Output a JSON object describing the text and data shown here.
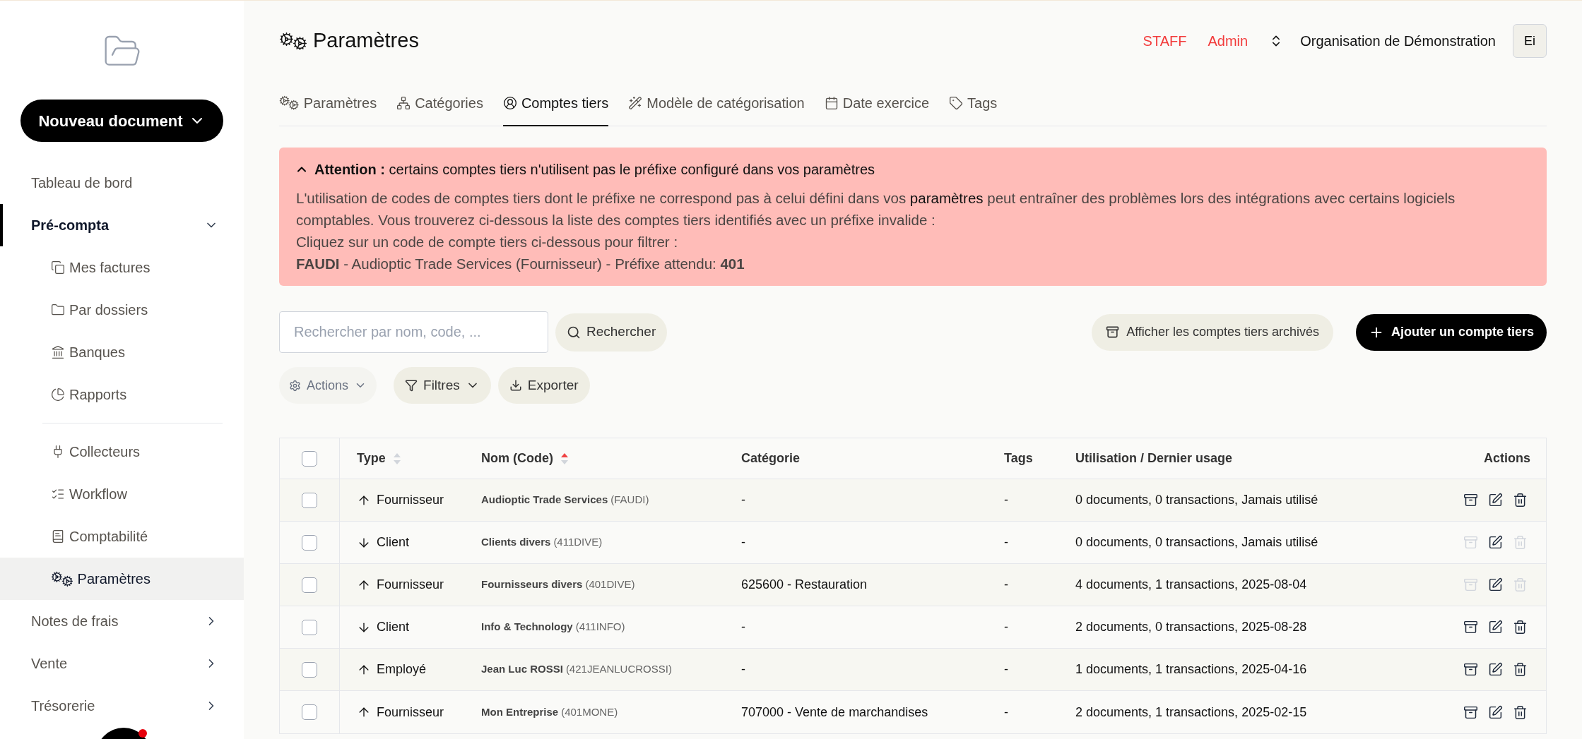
{
  "sidebar": {
    "new_document_button": "Nouveau document",
    "items": [
      {
        "label": "Tableau de bord",
        "kind": "link",
        "selected": false
      },
      {
        "label": "Pré-compta",
        "kind": "group",
        "selected": true,
        "expanded": true,
        "sections": [
          {
            "items": [
              {
                "label": "Mes factures",
                "selected": false
              },
              {
                "label": "Par dossiers",
                "selected": false
              },
              {
                "label": "Banques",
                "selected": false
              },
              {
                "label": "Rapports",
                "selected": false
              }
            ]
          },
          {
            "items": [
              {
                "label": "Collecteurs",
                "selected": false
              },
              {
                "label": "Workflow",
                "selected": false
              },
              {
                "label": "Comptabilité",
                "selected": false
              },
              {
                "label": "Paramètres",
                "selected": true
              }
            ]
          }
        ]
      },
      {
        "label": "Notes de frais",
        "kind": "group",
        "selected": false,
        "expanded": false
      },
      {
        "label": "Vente",
        "kind": "group",
        "selected": false,
        "expanded": false
      },
      {
        "label": "Trésorerie",
        "kind": "group",
        "selected": false,
        "expanded": false
      }
    ]
  },
  "header": {
    "title": "Paramètres",
    "staff": "STAFF",
    "role": "Admin",
    "organization": "Organisation de Démonstration",
    "avatar": "Ei"
  },
  "tabs": [
    {
      "label": "Paramètres",
      "selected": false
    },
    {
      "label": "Catégories",
      "selected": false
    },
    {
      "label": "Comptes tiers",
      "selected": true
    },
    {
      "label": "Modèle de catégorisation",
      "selected": false
    },
    {
      "label": "Date exercice",
      "selected": false
    },
    {
      "label": "Tags",
      "selected": false
    }
  ],
  "alert": {
    "expanded": true,
    "title": "**Attention :** certains comptes tiers n'utilisent pas le préfixe configuré dans vos paramètres",
    "body_before": "L'utilisation de codes de comptes tiers dont le préfixe ne correspond pas à celui défini dans vos",
    "body_link": "paramètres",
    "body_after": "peut entraîner des problèmes lors des intégrations avec certains logiciels comptables. Vous trouverez ci-dessous la liste des comptes tiers identifiés avec un préfixe invalide :",
    "instruction": "Cliquez sur un code de compte tiers ci-dessous pour filtrer :",
    "entries": [
      "**FAUDI** - Audioptic Trade Services (Fournisseur) - Préfixe attendu: **401**"
    ]
  },
  "toolbar": {
    "search": {
      "placeholder": "Rechercher par nom, code, ..."
    },
    "search_button": "Rechercher",
    "archived_button": "Afficher les comptes tiers archivés",
    "add_button": "Ajouter un compte tiers",
    "actions": {
      "label": "Actions",
      "disabled": true
    },
    "filters_button": "Filtres",
    "export_button": "Exporter"
  },
  "table": {
    "select_all_checked": false,
    "columns": [
      {
        "label": "Type",
        "sortable": true,
        "sorted": false
      },
      {
        "label": "Nom (Code)",
        "sortable": true,
        "sorted": true
      },
      {
        "label": "Catégorie"
      },
      {
        "label": "Tags"
      },
      {
        "label": "Utilisation / Dernier usage"
      },
      {
        "label": "Actions"
      }
    ],
    "rows": [
      {
        "checked": false,
        "outgoing": true,
        "type": "Fournisseur",
        "name": "Audioptic Trade Services",
        "code": "(FAUDI)",
        "category": "-",
        "tags": "-",
        "usage": "0 documents, 0 transactions, Jamais utilisé",
        "archive_disabled": false,
        "delete_disabled": false
      },
      {
        "checked": false,
        "outgoing": false,
        "type": "Client",
        "name": "Clients divers",
        "code": "(411DIVE)",
        "category": "-",
        "tags": "-",
        "usage": "0 documents, 0 transactions, Jamais utilisé",
        "archive_disabled": true,
        "delete_disabled": true
      },
      {
        "checked": false,
        "outgoing": true,
        "type": "Fournisseur",
        "name": "Fournisseurs divers",
        "code": "(401DIVE)",
        "category": "625600 - Restauration",
        "tags": "-",
        "usage": "4 documents, 1 transactions, 2025-08-04",
        "archive_disabled": true,
        "delete_disabled": true
      },
      {
        "checked": false,
        "outgoing": false,
        "type": "Client",
        "name": "Info & Technology",
        "code": "(411INFO)",
        "category": "-",
        "tags": "-",
        "usage": "2 documents, 0 transactions, 2025-08-28",
        "archive_disabled": false,
        "delete_disabled": false
      },
      {
        "checked": false,
        "outgoing": true,
        "type": "Employé",
        "name": "Jean Luc ROSSI",
        "code": "(421JEANLUCROSSI)",
        "category": "-",
        "tags": "-",
        "usage": "1 documents, 1 transactions, 2025-04-16",
        "archive_disabled": false,
        "delete_disabled": false
      },
      {
        "checked": false,
        "outgoing": true,
        "type": "Fournisseur",
        "name": "Mon Entreprise",
        "code": "(401MONE)",
        "category": "707000 - Vente de marchandises",
        "tags": "-",
        "usage": "2 documents, 1 transactions, 2025-02-15",
        "archive_disabled": false,
        "delete_disabled": false
      }
    ]
  }
}
